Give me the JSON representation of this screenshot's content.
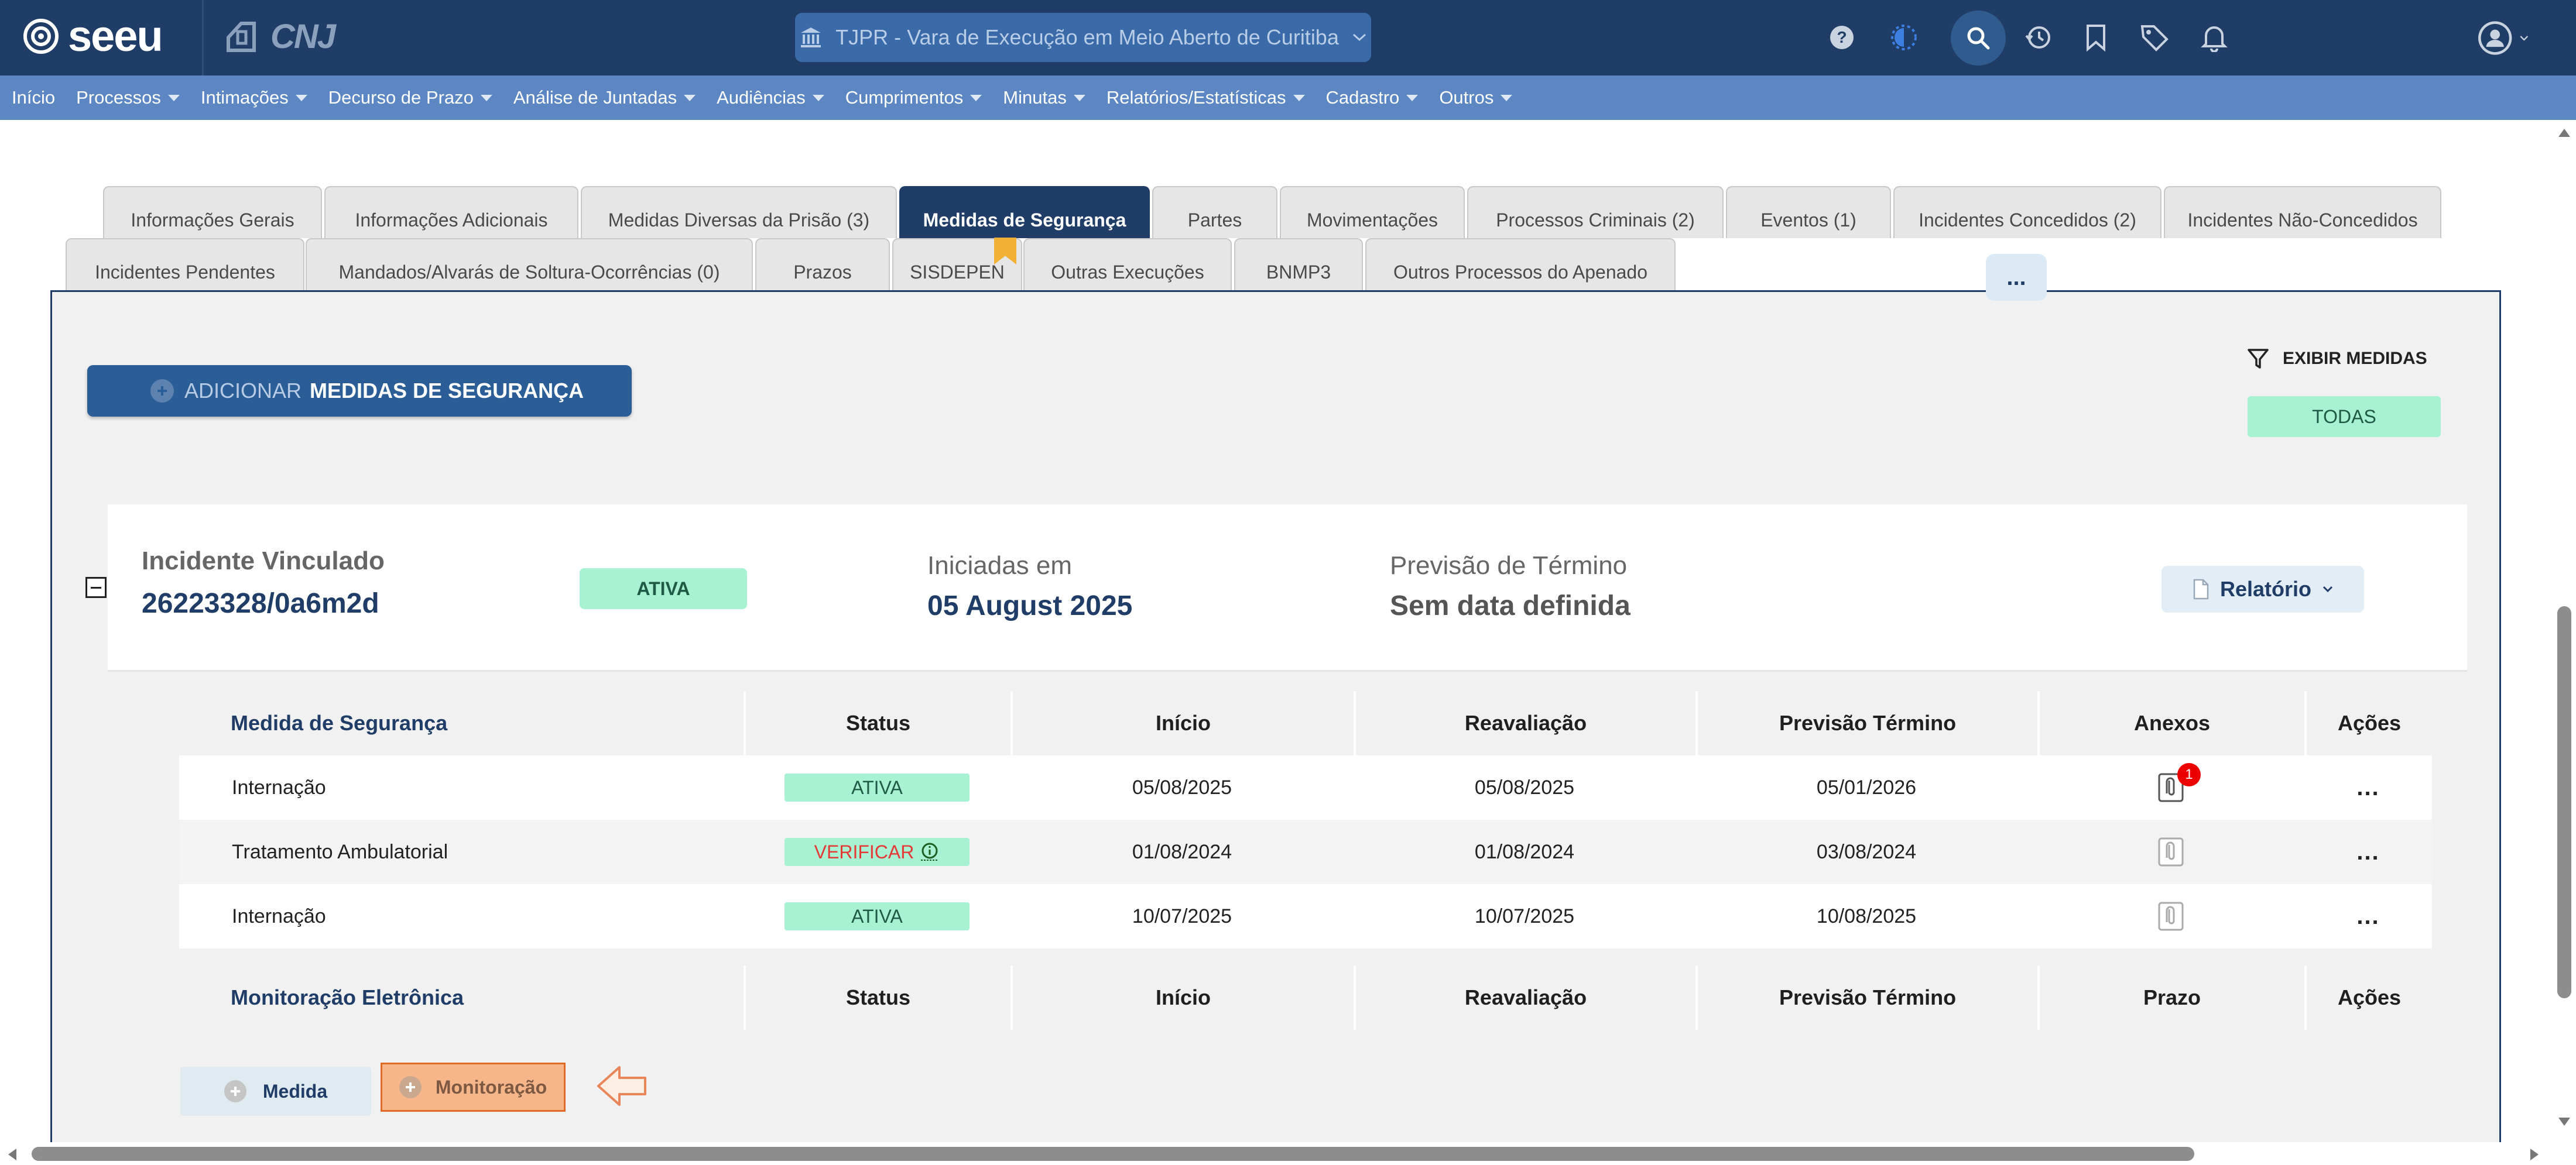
{
  "header": {
    "logo_text": "seeu",
    "cnj_text": "CNJ",
    "court_selector": "TJPR - Vara de Execução em Meio Aberto de Curitiba"
  },
  "menu": [
    {
      "label": "Início",
      "has_caret": false
    },
    {
      "label": "Processos",
      "has_caret": true
    },
    {
      "label": "Intimações",
      "has_caret": true
    },
    {
      "label": "Decurso de Prazo",
      "has_caret": true
    },
    {
      "label": "Análise de Juntadas",
      "has_caret": true
    },
    {
      "label": "Audiências",
      "has_caret": true
    },
    {
      "label": "Cumprimentos",
      "has_caret": true
    },
    {
      "label": "Minutas",
      "has_caret": true
    },
    {
      "label": "Relatórios/Estatísticas",
      "has_caret": true
    },
    {
      "label": "Cadastro",
      "has_caret": true
    },
    {
      "label": "Outros",
      "has_caret": true
    }
  ],
  "tabs_row1": [
    "Informações Gerais",
    "Informações Adicionais",
    "Medidas Diversas da Prisão (3)",
    "Medidas de Segurança",
    "Partes",
    "Movimentações",
    "Processos Criminais (2)",
    "Eventos (1)",
    "Incidentes Concedidos (2)",
    "Incidentes Não-Concedidos"
  ],
  "tabs_row2": [
    "Incidentes Pendentes",
    "Mandados/Alvarás de Soltura-Ocorrências (0)",
    "Prazos",
    "SISDEPEN",
    "Outras Execuções",
    "BNMP3",
    "Outros Processos do Apenado"
  ],
  "active_tab": "Medidas de Segurança",
  "panel": {
    "add_prefix": "ADICIONAR",
    "add_label": "MEDIDAS DE SEGURANÇA",
    "filter_label": "EXIBIR MEDIDAS",
    "filter_value": "TODAS"
  },
  "incident": {
    "title_label": "Incidente Vinculado",
    "number": "26223328/0a6m2d",
    "status": "ATIVA",
    "started_label": "Iniciadas em",
    "started_value": "05 August 2025",
    "forecast_label": "Previsão de Término",
    "forecast_value": "Sem data definida",
    "more_label": "...",
    "report_label": "Relatório"
  },
  "table1": {
    "headers": [
      "Medida de Segurança",
      "Status",
      "Início",
      "Reavaliação",
      "Previsão Término",
      "Anexos",
      "Ações"
    ],
    "rows": [
      {
        "medida": "Internação",
        "status": "ATIVA",
        "inicio": "05/08/2025",
        "reavaliacao": "05/08/2025",
        "previsao": "05/01/2026",
        "anexos_count": "1",
        "acoes": "..."
      },
      {
        "medida": "Tratamento Ambulatorial",
        "status": "VERIFICAR",
        "inicio": "01/08/2024",
        "reavaliacao": "01/08/2024",
        "previsao": "03/08/2024",
        "anexos_count": "",
        "acoes": "..."
      },
      {
        "medida": "Internação",
        "status": "ATIVA",
        "inicio": "10/07/2025",
        "reavaliacao": "10/07/2025",
        "previsao": "10/08/2025",
        "anexos_count": "",
        "acoes": "..."
      }
    ]
  },
  "table2": {
    "headers": [
      "Monitoração Eletrônica",
      "Status",
      "Início",
      "Reavaliação",
      "Previsão Término",
      "Prazo",
      "Ações"
    ]
  },
  "buttons": {
    "medida": "Medida",
    "monitoracao": "Monitoração"
  },
  "colors": {
    "header_bg": "#1f3d66",
    "menu_bg": "#5c87c2",
    "status_green": "#a8f1d3",
    "alert_red": "#e53935",
    "highlight_orange": "#f7b689"
  }
}
